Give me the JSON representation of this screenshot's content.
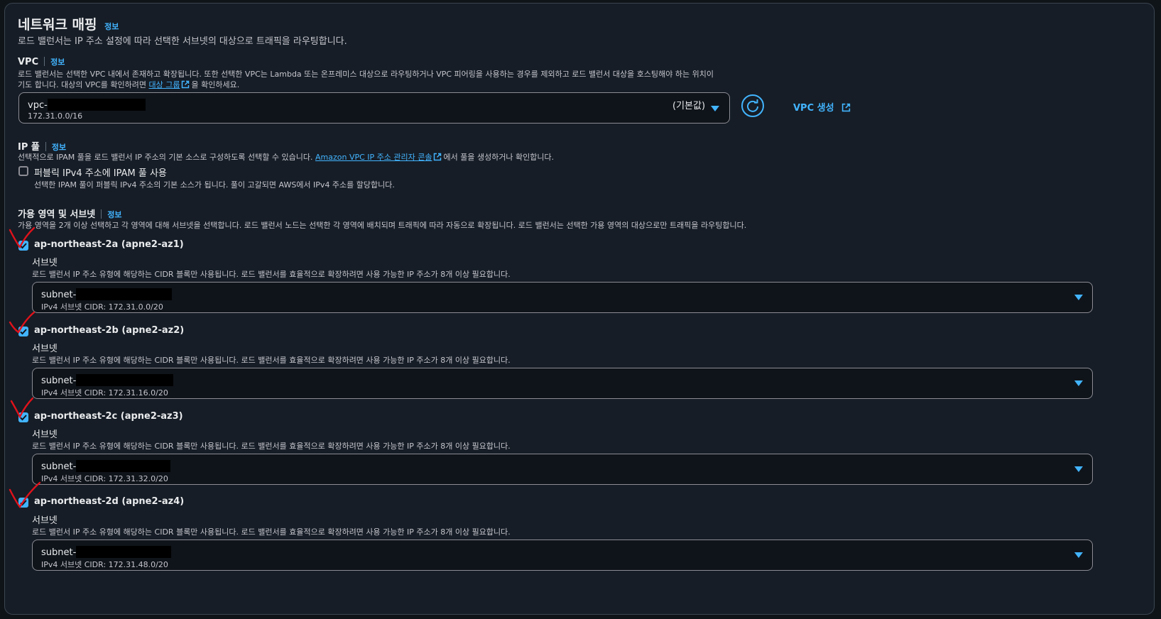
{
  "section": {
    "title": "네트워크 매핑",
    "info": "정보",
    "description": "로드 밸런서는 IP 주소 설정에 따라 선택한 서브넷의 대상으로 트래픽을 라우팅합니다."
  },
  "vpc": {
    "label": "VPC",
    "info": "정보",
    "desc_line1": "로드 밸런서는 선택한 VPC 내에서 존재하고 확장됩니다. 또한 선택한 VPC는 Lambda 또는 온프레미스 대상으로 라우팅하거나 VPC 피어링을 사용하는 경우를 제외하고 로드 밸런서 대상을 호스팅해야 하는 위치이",
    "desc_line2_pre": "기도 합니다. 대상의 VPC를 확인하려면 ",
    "desc_link": "대상 그룹",
    "desc_line2_post": "을 확인하세요.",
    "selected_prefix": "vpc-",
    "selected_default": "(기본값)",
    "selected_cidr": "172.31.0.0/16",
    "create_label": "VPC 생성"
  },
  "ip_pool": {
    "label": "IP 풀",
    "info": "정보",
    "desc_pre": "선택적으로 IPAM 풀을 로드 밸런서 IP 주소의 기본 소스로 구성하도록 선택할 수 있습니다. ",
    "desc_link": "Amazon VPC IP 주소 관리자 콘솔",
    "desc_post": "에서 풀을 생성하거나 확인합니다.",
    "checkbox_label": "퍼블릭 IPv4 주소에 IPAM 풀 사용",
    "checkbox_desc": "선택한 IPAM 풀이 퍼블릭 IPv4 주소의 기본 소스가 됩니다. 풀이 고갈되면 AWS에서 IPv4 주소를 할당합니다."
  },
  "az": {
    "label": "가용 영역 및 서브넷",
    "info": "정보",
    "description": "가용 영역을 2개 이상 선택하고 각 영역에 대해 서브넷을 선택합니다. 로드 밸런서 노드는 선택한 각 영역에 배치되며 트래픽에 따라 자동으로 확장됩니다. 로드 밸런서는 선택한 가용 영역의 대상으로만 트래픽을 라우팅합니다.",
    "zones": [
      {
        "name": "ap-northeast-2a (apne2-az1)",
        "subnet_label": "서브넷",
        "subnet_desc": "로드 밸런서 IP 주소 유형에 해당하는 CIDR 블록만 사용됩니다. 로드 밸런서를 효율적으로 확장하려면 사용 가능한 IP 주소가 8개 이상 필요합니다.",
        "subnet_prefix": "subnet-",
        "cidr": "IPv4 서브넷 CIDR: 172.31.0.0/20"
      },
      {
        "name": "ap-northeast-2b (apne2-az2)",
        "subnet_label": "서브넷",
        "subnet_desc": "로드 밸런서 IP 주소 유형에 해당하는 CIDR 블록만 사용됩니다. 로드 밸런서를 효율적으로 확장하려면 사용 가능한 IP 주소가 8개 이상 필요합니다.",
        "subnet_prefix": "subnet-",
        "cidr": "IPv4 서브넷 CIDR: 172.31.16.0/20"
      },
      {
        "name": "ap-northeast-2c (apne2-az3)",
        "subnet_label": "서브넷",
        "subnet_desc": "로드 밸런서 IP 주소 유형에 해당하는 CIDR 블록만 사용됩니다. 로드 밸런서를 효율적으로 확장하려면 사용 가능한 IP 주소가 8개 이상 필요합니다.",
        "subnet_prefix": "subnet-",
        "cidr": "IPv4 서브넷 CIDR: 172.31.32.0/20"
      },
      {
        "name": "ap-northeast-2d (apne2-az4)",
        "subnet_label": "서브넷",
        "subnet_desc": "로드 밸런서 IP 주소 유형에 해당하는 CIDR 블록만 사용됩니다. 로드 밸런서를 효율적으로 확장하려면 사용 가능한 IP 주소가 8개 이상 필요합니다.",
        "subnet_prefix": "subnet-",
        "cidr": "IPv4 서브넷 CIDR: 172.31.48.0/20"
      }
    ]
  },
  "colors": {
    "accent": "#42b4ff",
    "annotation": "#e0121b",
    "background": "#161d26"
  }
}
